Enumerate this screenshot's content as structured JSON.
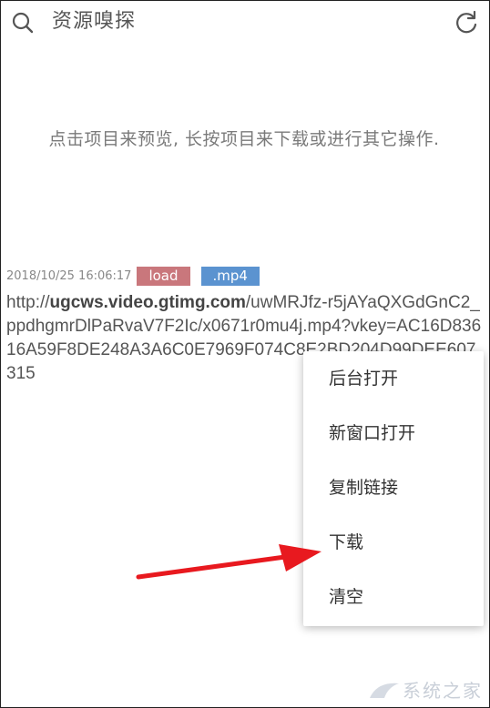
{
  "header": {
    "title": "资源嗅探",
    "search_icon": "search-icon",
    "refresh_icon": "refresh-icon"
  },
  "hint": "点击项目来预览, 长按项目来下载或进行其它操作.",
  "item": {
    "timestamp": "2018/10/25 16:06:17",
    "badge_load": "load",
    "badge_type": ".mp4",
    "url_prefix": "http://",
    "url_host": "ugcws.video.gtimg.com",
    "url_rest": "/uwMRJfz-r5jAYaQXGdGnC2_ppdhgmrDlPaRvaV7F2Ic/x0671r0mu4j.mp4?vkey=AC16D83616A59F8DE248A3A6C0E7969F074C8E2BD204D99DEE607315"
  },
  "context_menu": {
    "items": [
      "后台打开",
      "新窗口打开",
      "复制链接",
      "下载",
      "清空"
    ]
  },
  "watermark": "系统之家",
  "colors": {
    "badge_load": "#c9777c",
    "badge_type": "#5b93d0",
    "arrow": "#e8191f"
  }
}
